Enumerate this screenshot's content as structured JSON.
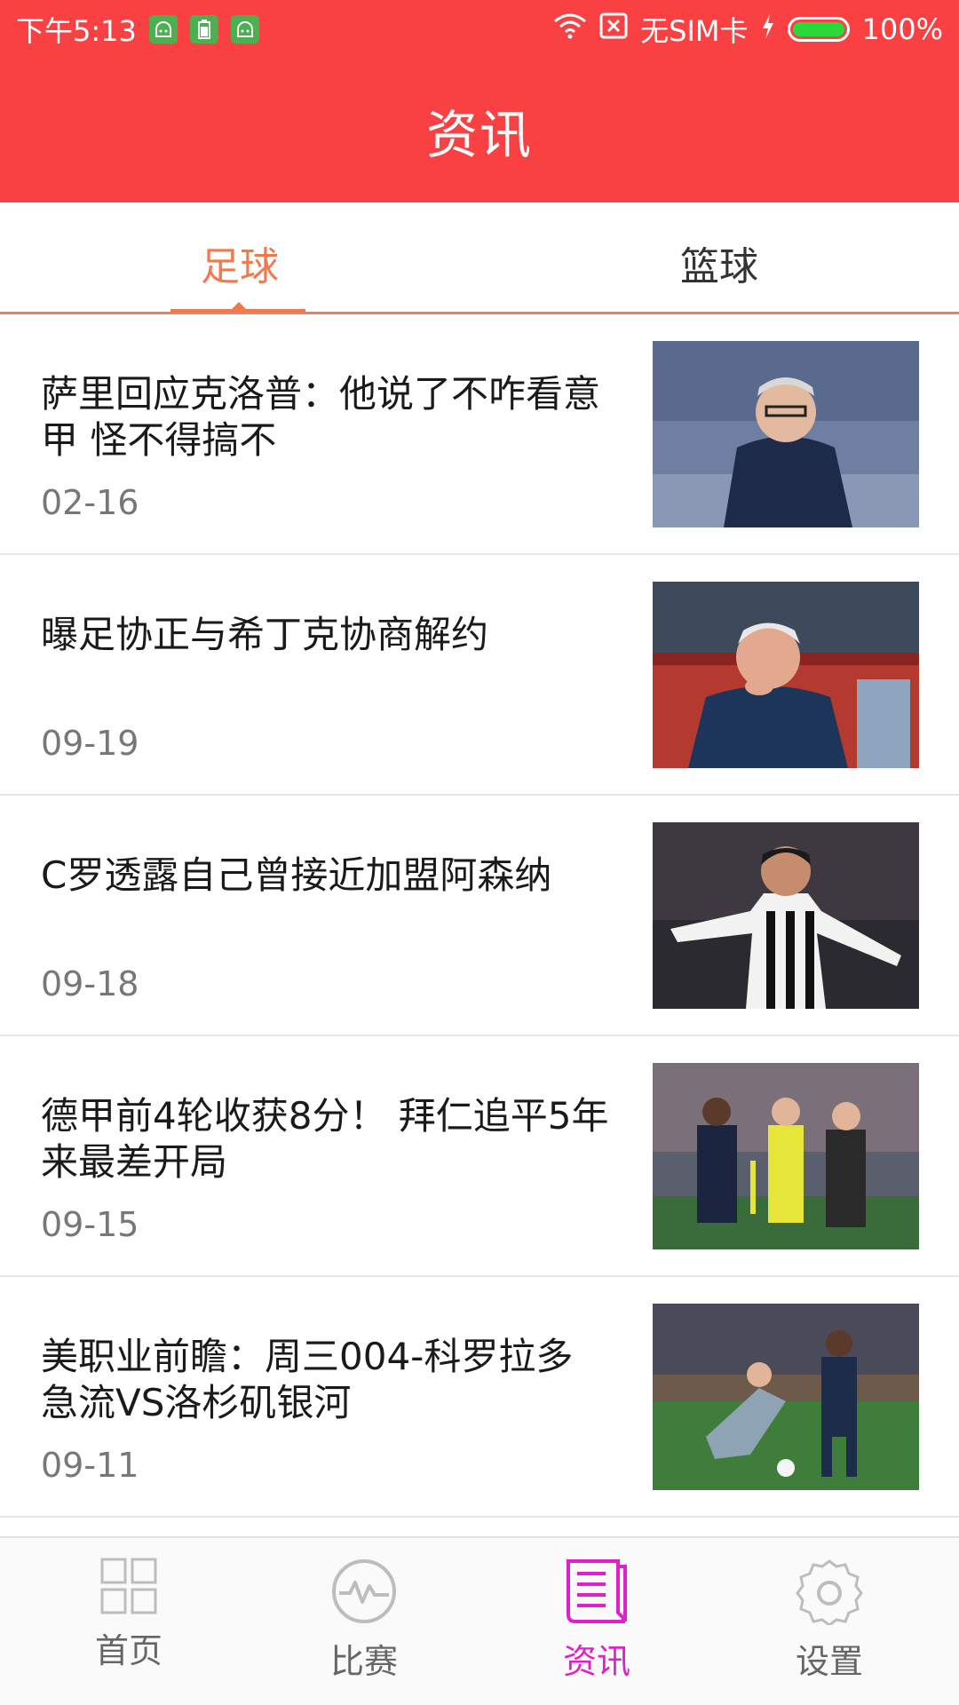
{
  "status_bar": {
    "time": "下午5:13",
    "carrier": "无SIM卡",
    "battery": "100%"
  },
  "header": {
    "title": "资讯"
  },
  "tabs": [
    {
      "label": "足球",
      "active": true
    },
    {
      "label": "篮球",
      "active": false
    }
  ],
  "news": [
    {
      "title": "萨里回应克洛普：他说了不咋看意甲 怪不得搞不",
      "date": "02-16"
    },
    {
      "title": "曝足协正与希丁克协商解约",
      "date": "09-19"
    },
    {
      "title": "C罗透露自己曾接近加盟阿森纳",
      "date": "09-18"
    },
    {
      "title": "德甲前4轮收获8分！ 拜仁追平5年来最差开局",
      "date": "09-15"
    },
    {
      "title": "美职业前瞻：周三004-科罗拉多急流VS洛杉矶银河",
      "date": "09-11"
    }
  ],
  "bottom_nav": [
    {
      "label": "首页",
      "icon": "grid-icon",
      "active": false
    },
    {
      "label": "比赛",
      "icon": "pulse-icon",
      "active": false
    },
    {
      "label": "资讯",
      "icon": "book-icon",
      "active": true
    },
    {
      "label": "设置",
      "icon": "gear-icon",
      "active": false
    }
  ],
  "colors": {
    "header_bg": "#f94144",
    "tab_active": "#f07a4e",
    "nav_active": "#e020c8"
  }
}
